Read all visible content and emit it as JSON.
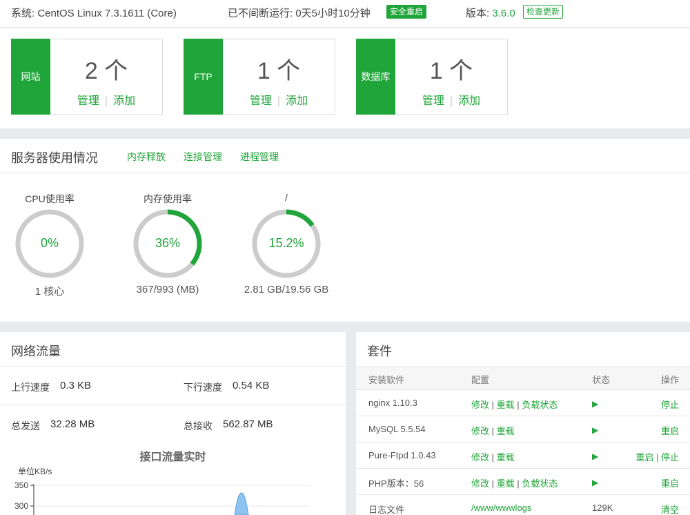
{
  "topbar": {
    "system": "系统: CentOS Linux 7.3.1611 (Core)",
    "uptime": "已不间断运行: 0天5小时10分钟",
    "restart_label": "安全重启",
    "version_label": "版本:",
    "version_value": "3.6.0",
    "update_label": "检查更新"
  },
  "stats": [
    {
      "tag": "网站",
      "count": "2 个",
      "manage": "管理",
      "add": "添加"
    },
    {
      "tag": "FTP",
      "count": "1 个",
      "manage": "管理",
      "add": "添加"
    },
    {
      "tag": "数据库",
      "count": "1 个",
      "manage": "管理",
      "add": "添加"
    }
  ],
  "server": {
    "title": "服务器使用情况",
    "links": [
      "内存释放",
      "连接管理",
      "进程管理"
    ],
    "gauges": [
      {
        "label": "CPU使用率",
        "value": "0%",
        "percent": 0,
        "sub": "1 核心"
      },
      {
        "label": "内存使用率",
        "value": "36%",
        "percent": 36,
        "sub": "367/993 (MB)"
      },
      {
        "label": "/",
        "value": "15.2%",
        "percent": 15.2,
        "sub": "2.81 GB/19.56 GB"
      }
    ]
  },
  "network": {
    "title": "网络流量",
    "up_label": "上行速度",
    "up_value": "0.3 KB",
    "down_label": "下行速度",
    "down_value": "0.54 KB",
    "sent_label": "总发送",
    "sent_value": "32.28 MB",
    "recv_label": "总接收",
    "recv_value": "562.87 MB",
    "chart_title": "接口流量实时",
    "chart_unit": "单位KB/s",
    "chart_ticks": [
      "350",
      "300"
    ]
  },
  "software": {
    "title": "套件",
    "headers": [
      "安装软件",
      "配置",
      "状态",
      "操作"
    ],
    "rows": [
      {
        "name": "nginx 1.10.3",
        "config": [
          "修改",
          "重载",
          "负载状态"
        ],
        "status": "▶",
        "action": "停止"
      },
      {
        "name": "MySQL 5.5.54",
        "config": [
          "修改",
          "重载"
        ],
        "status": "▶",
        "action": "重启"
      },
      {
        "name": "Pure-Ftpd 1.0.43",
        "config": [
          "修改",
          "重载"
        ],
        "status": "▶",
        "action": "重启 | 停止"
      },
      {
        "name": "PHP版本：56",
        "config": [
          "修改",
          "重载",
          "负载状态"
        ],
        "status": "▶",
        "action": "重启"
      },
      {
        "name": "日志文件",
        "config": [
          "/www/wwwlogs"
        ],
        "status": "129K",
        "action": "清空"
      }
    ]
  },
  "colors": {
    "accent": "#20a53a",
    "track": "#cccccc"
  }
}
